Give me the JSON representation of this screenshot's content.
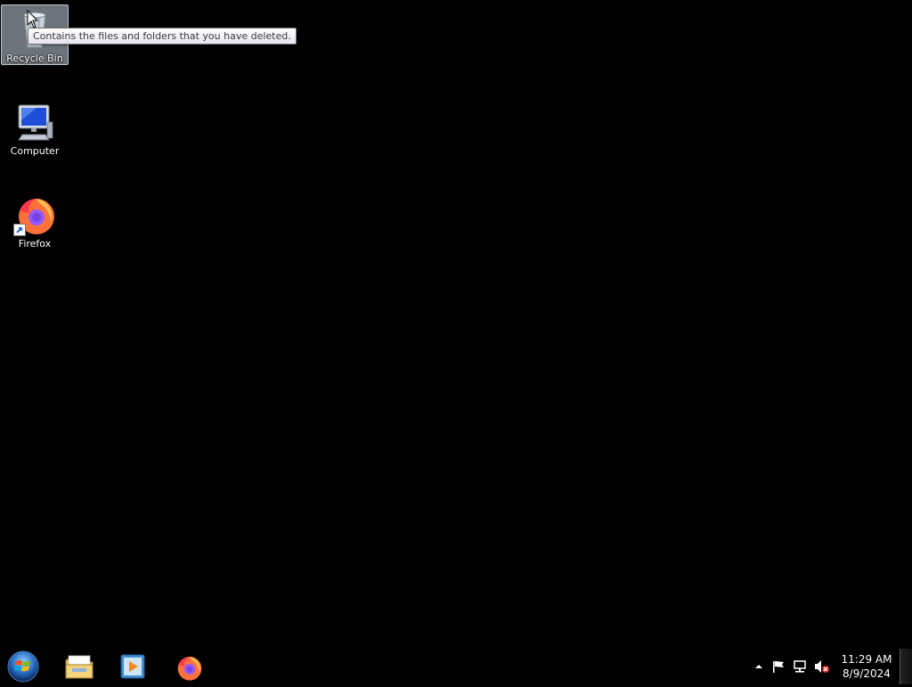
{
  "desktop": {
    "icons": [
      {
        "label": "Recycle Bin",
        "icon": "recycle-bin-icon",
        "selected": true
      },
      {
        "label": "Computer",
        "icon": "computer-icon",
        "selected": false
      },
      {
        "label": "Firefox",
        "icon": "firefox-icon",
        "selected": false,
        "shortcut": true
      }
    ],
    "tooltip": "Contains the files and folders that you have deleted."
  },
  "taskbar": {
    "start_icon": "windows-start-orb-icon",
    "pinned": [
      {
        "icon": "file-explorer-icon"
      },
      {
        "icon": "media-player-icon"
      },
      {
        "icon": "firefox-icon"
      }
    ],
    "tray": {
      "icons": [
        "show-hidden-icons-arrow",
        "action-center-flag-icon",
        "network-icon",
        "volume-muted-icon"
      ],
      "time": "11:29 AM",
      "date": "8/9/2024"
    }
  },
  "colors": {
    "desktop_background": "#000000",
    "selection": "#96a0aa",
    "tooltip_border": "#767676"
  }
}
